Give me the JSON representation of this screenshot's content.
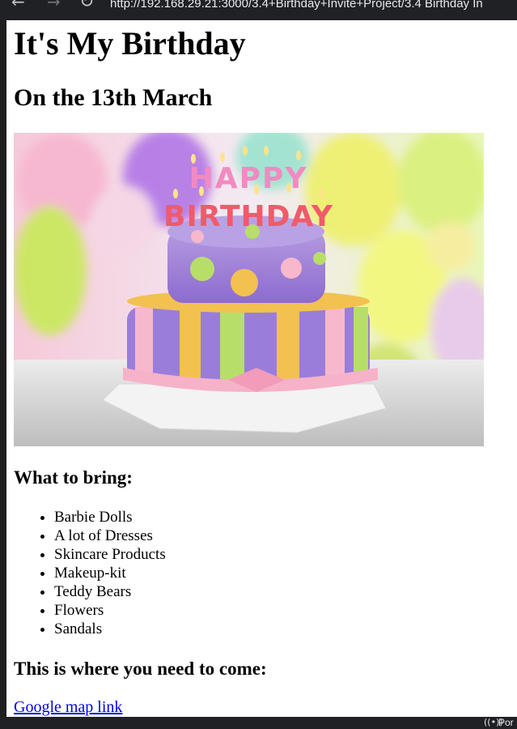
{
  "browser": {
    "back_icon": "←",
    "forward_icon": "→",
    "reload_icon": "↻",
    "url": "http://192.168.29.21:3000/3.4+Birthday+Invite+Project/3.4 Birthday In"
  },
  "page": {
    "title": "It's My Birthday",
    "date_heading": "On the 13th March",
    "image": {
      "subject": "birthday cake",
      "cake_topper_line1": "HAPPY",
      "cake_topper_line2": "BIRTHDAY"
    },
    "bring_heading": "What to bring:",
    "bring_items": [
      "Barbie Dolls",
      "A lot of Dresses",
      "Skincare Products",
      "Makeup-kit",
      "Teddy Bears",
      "Flowers",
      "Sandals"
    ],
    "come_heading": "This is where you need to come:",
    "map_link": "Google map link"
  },
  "taskbar": {
    "icon": "((•))",
    "text": "Por"
  },
  "colors": {
    "link": "#0000ee",
    "chrome": "#202124",
    "page_bg": "#ffffff"
  }
}
